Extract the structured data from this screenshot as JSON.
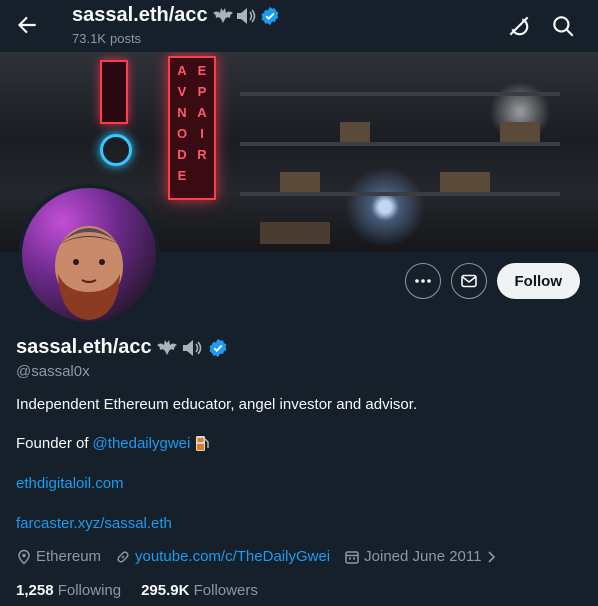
{
  "header": {
    "name": "sassal.eth/acc",
    "posts_count": "73.1K",
    "posts_label": "posts"
  },
  "profile": {
    "display_name": "sassal.eth/acc",
    "handle": "@sassal0x",
    "bio": "Independent Ethereum educator, angel investor and advisor.",
    "founder_prefix": "Founder of",
    "founder_link": "@thedailygwei",
    "links": [
      "ethdigitaloil.com",
      "farcaster.xyz/sassal.eth"
    ],
    "location": "Ethereum",
    "website": "youtube.com/c/TheDailyGwei",
    "joined": "Joined June 2011"
  },
  "banner": {
    "neon_col1": [
      "A",
      "V",
      "N",
      "O",
      "D",
      "E"
    ],
    "neon_col2": [
      "E",
      "P",
      "A",
      "I",
      "R"
    ]
  },
  "actions": {
    "follow_label": "Follow"
  },
  "stats": {
    "following_count": "1,258",
    "following_label": "Following",
    "followers_count": "295.9K",
    "followers_label": "Followers"
  },
  "colors": {
    "background": "#15202b",
    "accent": "#1d9bf0",
    "muted": "#8b98a5",
    "verified": "#1d9bf0"
  },
  "icons": [
    "back-arrow-icon",
    "grok-icon",
    "search-icon",
    "more-icon",
    "message-icon",
    "verified-badge-icon",
    "bat-emoji-icon",
    "speaker-emoji-icon",
    "fuel-pump-emoji-icon",
    "location-icon",
    "link-icon",
    "calendar-icon",
    "chevron-right-icon"
  ]
}
